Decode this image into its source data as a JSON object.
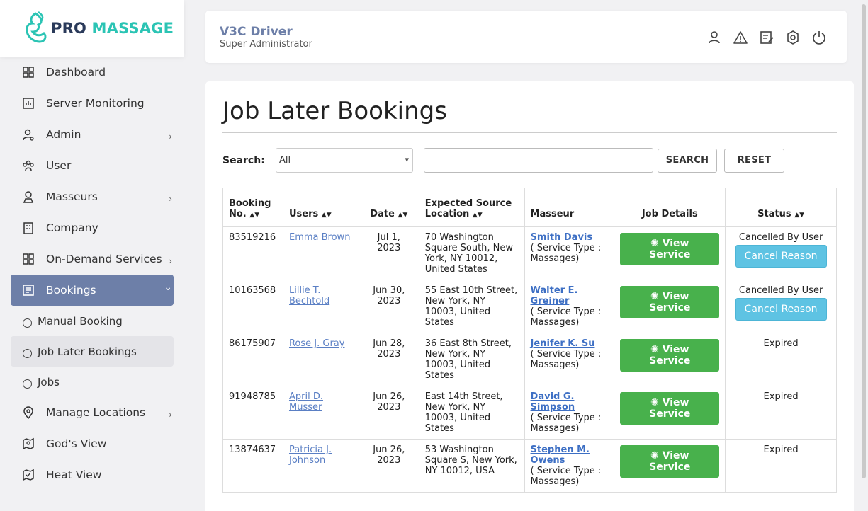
{
  "brand": {
    "logo_a": "PRO",
    "logo_b": "MASSAGE"
  },
  "sidebar": {
    "items": [
      {
        "label": "Dashboard",
        "icon": "dashboard-icon"
      },
      {
        "label": "Server Monitoring",
        "icon": "chart-icon"
      },
      {
        "label": "Admin",
        "icon": "admin-icon",
        "expandable": true
      },
      {
        "label": "User",
        "icon": "users-icon"
      },
      {
        "label": "Masseurs",
        "icon": "masseur-icon",
        "expandable": true
      },
      {
        "label": "Company",
        "icon": "company-icon"
      },
      {
        "label": "On-Demand Services",
        "icon": "grid-icon",
        "expandable": true
      },
      {
        "label": "Bookings",
        "icon": "bookings-icon",
        "expandable": true,
        "active": true
      }
    ],
    "sub_items": [
      {
        "label": "Manual Booking"
      },
      {
        "label": "Job Later Bookings",
        "active": true
      },
      {
        "label": "Jobs"
      }
    ],
    "items_after": [
      {
        "label": "Manage Locations",
        "icon": "location-icon",
        "expandable": true
      },
      {
        "label": "God's View",
        "icon": "map-icon"
      },
      {
        "label": "Heat View",
        "icon": "heat-icon"
      }
    ]
  },
  "header": {
    "name": "V3C Driver",
    "role": "Super Administrator"
  },
  "page": {
    "title": "Job Later Bookings"
  },
  "search": {
    "label": "Search:",
    "selected": "All",
    "search_button": "SEARCH",
    "reset_button": "RESET"
  },
  "table": {
    "headers": {
      "booking_no": "Booking No.",
      "users": "Users",
      "date": "Date",
      "location": "Expected Source Location",
      "masseur": "Masseur",
      "job_details": "Job Details",
      "status": "Status"
    },
    "service_type_text": "( Service Type : Massages)",
    "view_label": "View Service",
    "cancel_label": "Cancel Reason",
    "rows": [
      {
        "booking_no": "83519216",
        "user": "Emma Brown",
        "date": "Jul 1, 2023",
        "location": "70 Washington Square South, New York, NY 10012, United States",
        "masseur": "Smith Davis",
        "status": "Cancelled By User",
        "cancel": true
      },
      {
        "booking_no": "10163568",
        "user": "Lillie T. Bechtold",
        "date": "Jun 30, 2023",
        "location": "55 East 10th Street, New York, NY 10003, United States",
        "masseur": "Walter E. Greiner",
        "status": "Cancelled By User",
        "cancel": true
      },
      {
        "booking_no": "86175907",
        "user": "Rose J. Gray",
        "date": "Jun 28, 2023",
        "location": "36 East 8th Street, New York, NY 10003, United States",
        "masseur": "Jenifer K. Su",
        "status": "Expired",
        "cancel": false
      },
      {
        "booking_no": "91948785",
        "user": "April D. Musser",
        "date": "Jun 26, 2023",
        "location": "East 14th Street, New York, NY 10003, United States",
        "masseur": "David G. Simpson",
        "status": "Expired",
        "cancel": false
      },
      {
        "booking_no": "13874637",
        "user": "Patricia J. Johnson",
        "date": "Jun 26, 2023",
        "location": "53 Washington Square S, New York, NY 10012, USA",
        "masseur": "Stephen M. Owens",
        "status": "Expired",
        "cancel": false
      }
    ]
  },
  "colors": {
    "accent": "#6d7fa8",
    "brand_teal": "#2bc4b4",
    "success": "#48b14c",
    "info": "#5ec3e3",
    "link": "#5a7fc4"
  }
}
